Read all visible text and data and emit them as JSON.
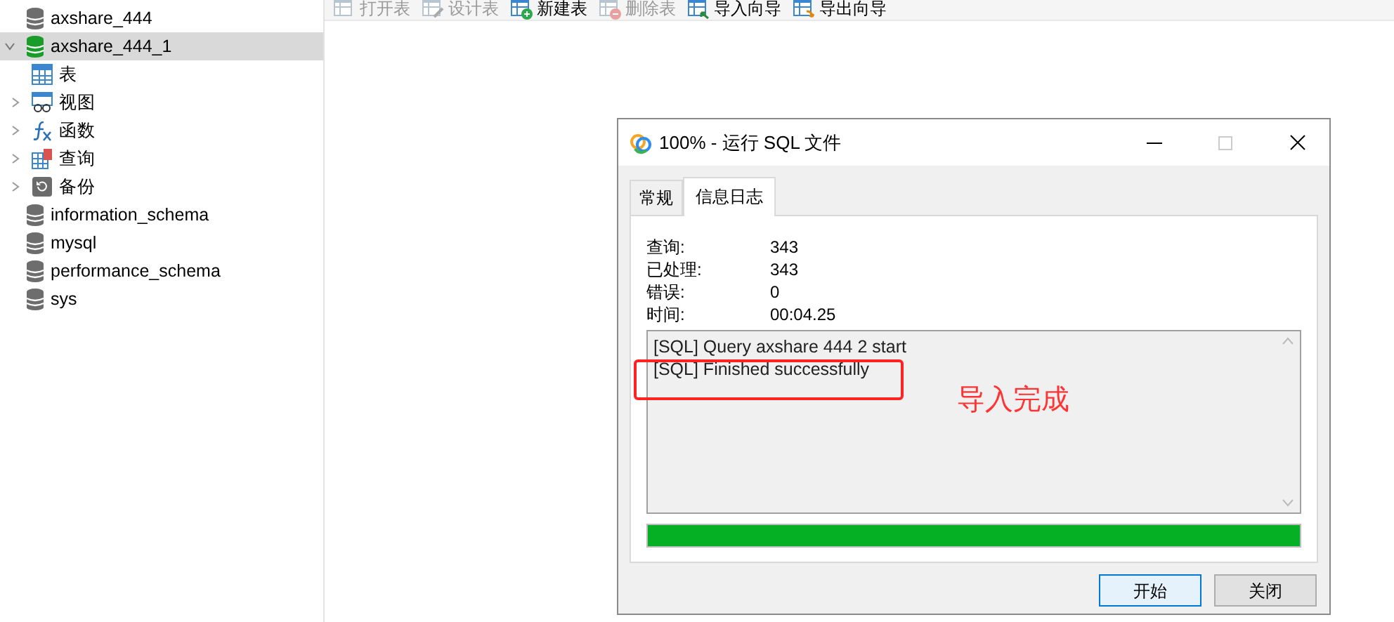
{
  "toolbar": [
    {
      "label": "打开表",
      "kind": "open",
      "disabled": true
    },
    {
      "label": "设计表",
      "kind": "design",
      "disabled": true
    },
    {
      "label": "新建表",
      "kind": "new",
      "disabled": false
    },
    {
      "label": "删除表",
      "kind": "delete",
      "disabled": true
    },
    {
      "label": "导入向导",
      "kind": "import",
      "disabled": false
    },
    {
      "label": "导出向导",
      "kind": "export",
      "disabled": false
    }
  ],
  "sidebar": {
    "items": [
      {
        "label": "axshare_444",
        "connected": false,
        "expanded": false,
        "selected": false
      },
      {
        "label": "axshare_444_1",
        "connected": true,
        "expanded": true,
        "selected": true,
        "children": [
          {
            "label": "表",
            "kind": "table",
            "expandable": false
          },
          {
            "label": "视图",
            "kind": "view",
            "expandable": true
          },
          {
            "label": "函数",
            "kind": "function",
            "expandable": true
          },
          {
            "label": "查询",
            "kind": "query",
            "expandable": true
          },
          {
            "label": "备份",
            "kind": "backup",
            "expandable": true
          }
        ]
      },
      {
        "label": "information_schema",
        "connected": false,
        "expanded": false,
        "selected": false
      },
      {
        "label": "mysql",
        "connected": false,
        "expanded": false,
        "selected": false
      },
      {
        "label": "performance_schema",
        "connected": false,
        "expanded": false,
        "selected": false
      },
      {
        "label": "sys",
        "connected": false,
        "expanded": false,
        "selected": false
      }
    ]
  },
  "dialog": {
    "title": "100% - 运行 SQL 文件",
    "tabs": [
      {
        "label": "常规",
        "selected": false
      },
      {
        "label": "信息日志",
        "selected": true
      }
    ],
    "stats": [
      {
        "label": "查询:",
        "value": "343"
      },
      {
        "label": "已处理:",
        "value": "343"
      },
      {
        "label": "错误:",
        "value": "0"
      },
      {
        "label": "时间:",
        "value": "00:04.25"
      }
    ],
    "log": [
      "[SQL] Query axshare 444 2 start",
      "[SQL] Finished successfully"
    ],
    "progress": {
      "level": 1
    },
    "buttons": [
      {
        "label": "开始",
        "default": true
      },
      {
        "label": "关闭",
        "default": false
      }
    ],
    "annotation": {
      "text": "导入完成"
    }
  }
}
